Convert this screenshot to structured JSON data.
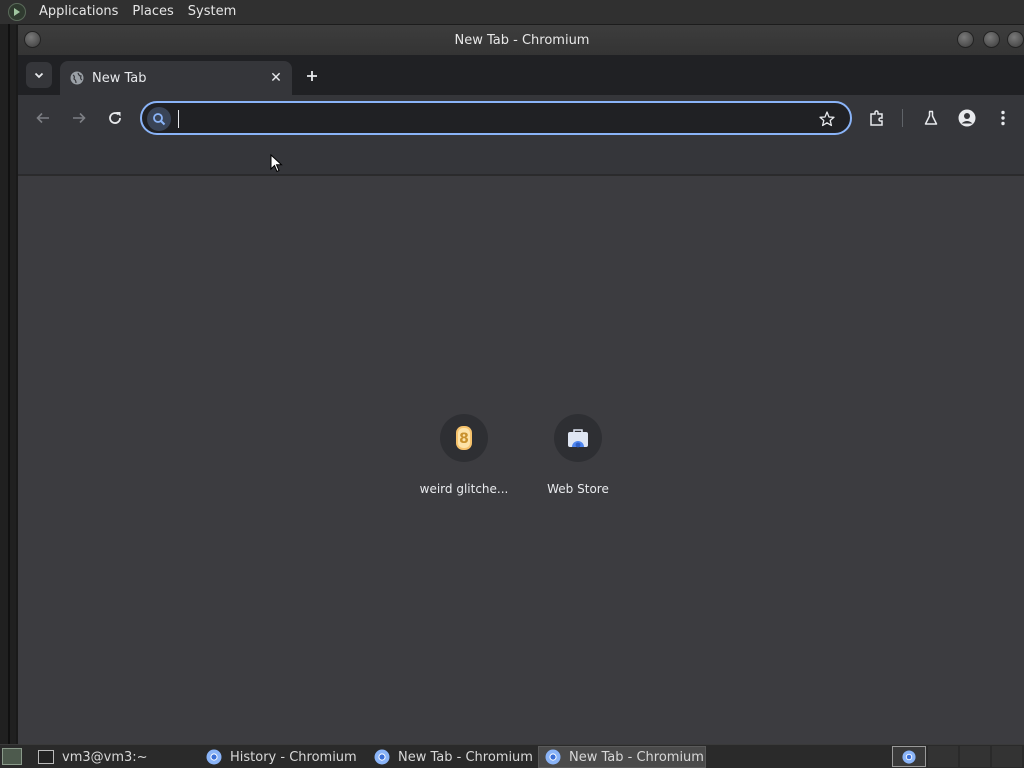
{
  "top_panel": {
    "menus": [
      "Applications",
      "Places",
      "System"
    ]
  },
  "window": {
    "title": "New Tab - Chromium"
  },
  "tabs": [
    {
      "title": "New Tab",
      "active": true
    }
  ],
  "omnibox": {
    "value": "",
    "placeholder": ""
  },
  "shortcuts": [
    {
      "label": "weird glitche...",
      "icon": "bitcoin-like-icon"
    },
    {
      "label": "Web Store",
      "icon": "web-store-icon"
    }
  ],
  "taskbar": {
    "items": [
      {
        "label": "vm3@vm3:~",
        "icon": "terminal-icon",
        "active": false
      },
      {
        "label": "History - Chromium",
        "icon": "chromium-icon",
        "active": false
      },
      {
        "label": "New Tab - Chromium",
        "icon": "chromium-icon",
        "active": false
      },
      {
        "label": "New Tab - Chromium",
        "icon": "chromium-icon",
        "active": true
      }
    ]
  },
  "colors": {
    "accent": "#8ab4f8",
    "toolbar": "#35363a",
    "content_bg": "#3c3c40"
  }
}
